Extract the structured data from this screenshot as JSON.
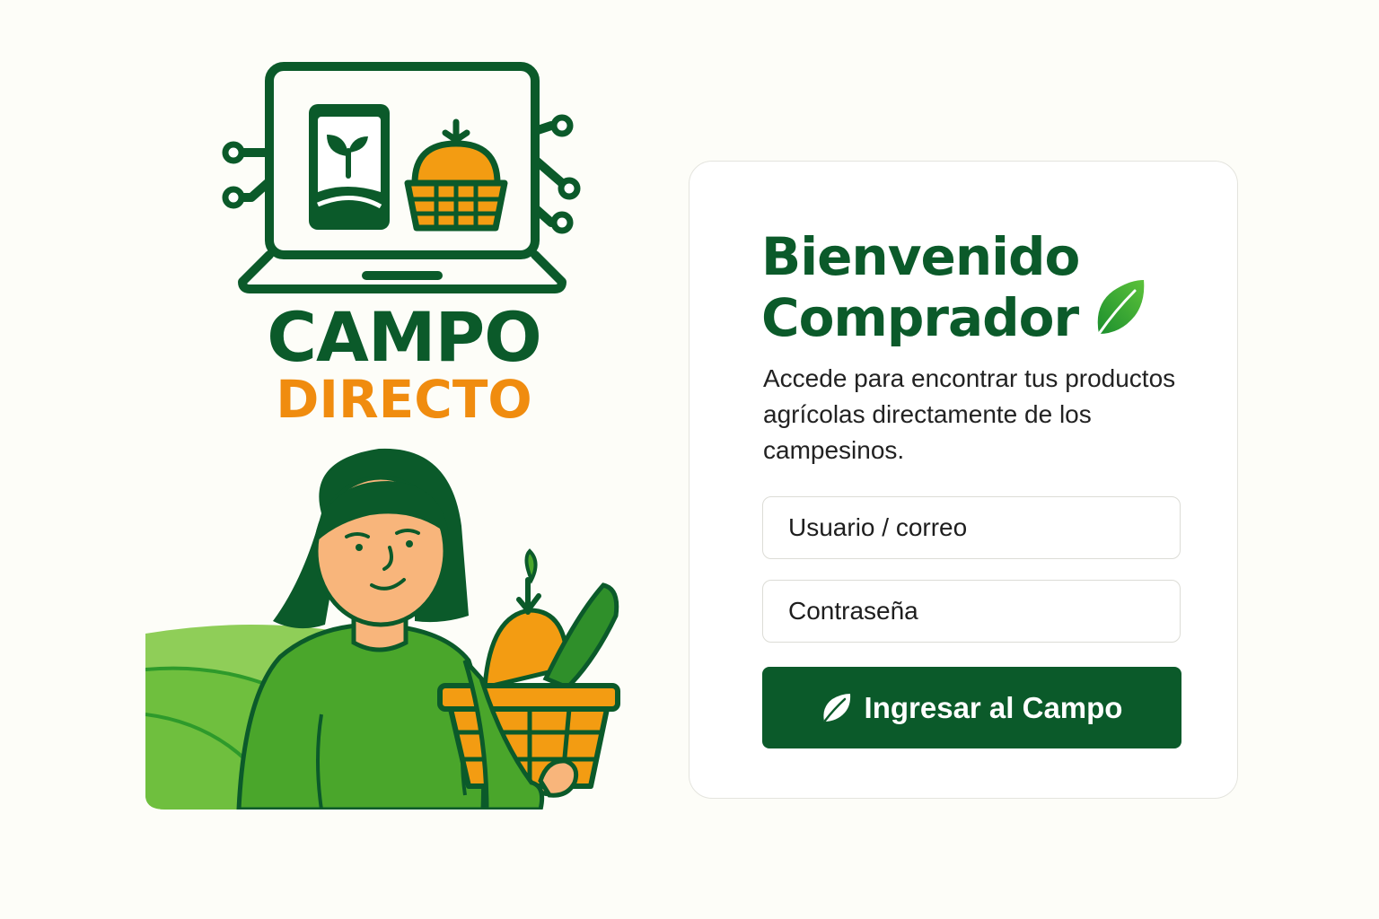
{
  "brand": {
    "name_line1": "CAMPO",
    "name_line2": "DIRECTO",
    "logo_icon": "laptop-farm-basket-icon",
    "illustration": "woman-holding-vegetable-basket",
    "colors": {
      "primary_green": "#0b5a2a",
      "accent_orange": "#f08c0f",
      "light_green": "#4aa62b"
    }
  },
  "login": {
    "title_line1": "Bienvenido",
    "title_line2": "Comprador",
    "title_icon": "leaf-icon",
    "subtitle": "Accede para encontrar tus productos agrícolas directamente de los campesinos.",
    "username_placeholder": "Usuario / correo",
    "password_placeholder": "Contraseña",
    "submit_label": "Ingresar al Campo",
    "submit_icon": "leaf-icon"
  }
}
